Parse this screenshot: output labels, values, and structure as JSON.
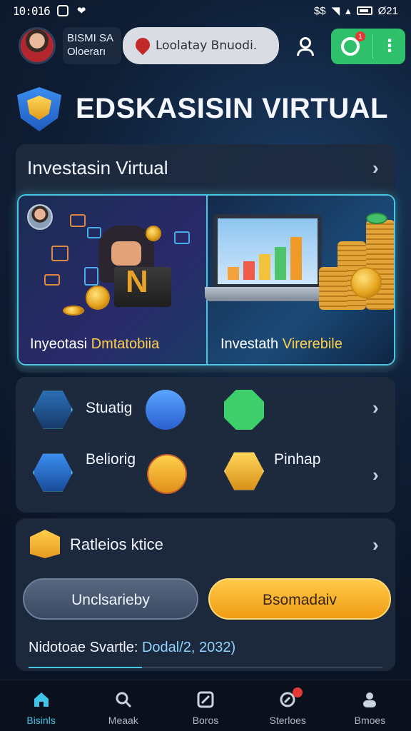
{
  "status_bar": {
    "time": "10:016",
    "network": "$$",
    "battery": "Ø21"
  },
  "header": {
    "user_line1": "BISMI SA",
    "user_line2": "Oloerarı",
    "search_text": "Loolatay Bnuodi.",
    "notification_count": "1"
  },
  "page_title": "EDSKASISIN VIRTUAL",
  "investasi_card": {
    "title": "Investasin Virtual",
    "left_label": "Inyeotasi",
    "left_highlight": "Dmtatobiia",
    "right_label": "Investath",
    "right_highlight": "Virerebile"
  },
  "shortcut_card": {
    "item1_label": "Stuatig",
    "item2_label": "Beliorig",
    "item3_label": "Pinhap",
    "icons": [
      "cube-hex-icon",
      "link-circle-icon",
      "gear-chat-icon",
      "server-hex-icon",
      "box-gold-icon",
      "stack-gold-icon"
    ]
  },
  "market_card": {
    "title": "Ratleios ktice",
    "btn_secondary": "Unclsarieby",
    "btn_primary": "Bsomadaiv",
    "meta_label": "Nidotoae Svartle:",
    "meta_value": "Dodal/2, 2032)",
    "progress_fraction": 0.32
  },
  "bottom_nav": {
    "items": [
      {
        "label": "Bisinls",
        "icon": "home-icon"
      },
      {
        "label": "Meaak",
        "icon": "search-icon"
      },
      {
        "label": "Boros",
        "icon": "chart-icon"
      },
      {
        "label": "Sterloes",
        "icon": "compass-icon"
      },
      {
        "label": "Bmoes",
        "icon": "group-icon"
      }
    ],
    "active_index": 0,
    "badge_item_index": 3
  },
  "colors": {
    "accent": "#49c7e0",
    "primary_button": "#f5ad22",
    "green": "#2ec06a"
  }
}
